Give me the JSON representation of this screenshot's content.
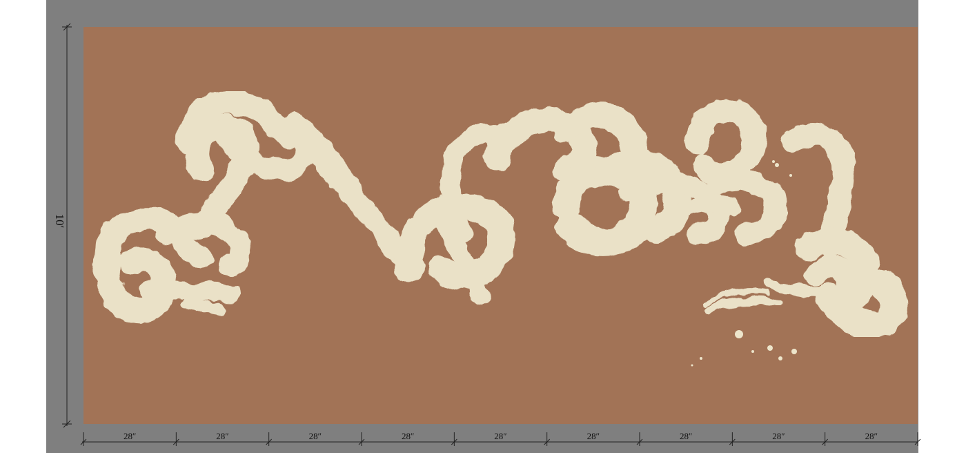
{
  "mural": {
    "background_color": "#a27356",
    "stroke_color": "#ede5cb",
    "frame_color": "#7f7f7f"
  },
  "dimensions": {
    "height_label": "10′",
    "panels": [
      "28″",
      "28″",
      "28″",
      "28″",
      "28″",
      "28″",
      "28″",
      "28″",
      "28″"
    ]
  }
}
